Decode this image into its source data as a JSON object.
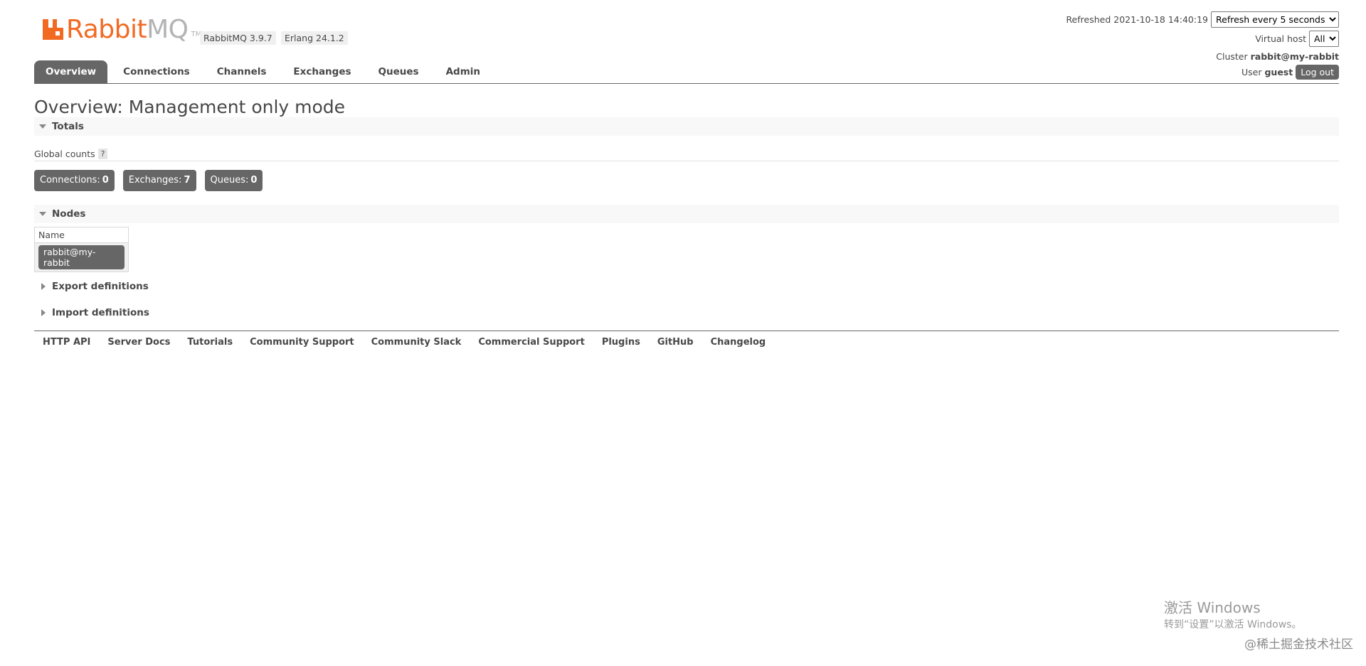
{
  "header": {
    "logo_text_rabbit": "Rabbit",
    "logo_text_mq": "MQ",
    "logo_tm": "TM",
    "rabbitmq_version": "RabbitMQ 3.9.7",
    "erlang_version": "Erlang 24.1.2",
    "refreshed_label": "Refreshed 2021-10-18 14:40:19",
    "refresh_select_value": "Refresh every 5 seconds",
    "virtual_host_label": "Virtual host",
    "virtual_host_value": "All",
    "cluster_label": "Cluster",
    "cluster_value": "rabbit@my-rabbit",
    "user_label": "User",
    "user_value": "guest",
    "logout_label": "Log out"
  },
  "tabs": [
    {
      "label": "Overview",
      "active": true
    },
    {
      "label": "Connections",
      "active": false
    },
    {
      "label": "Channels",
      "active": false
    },
    {
      "label": "Exchanges",
      "active": false
    },
    {
      "label": "Queues",
      "active": false
    },
    {
      "label": "Admin",
      "active": false
    }
  ],
  "main": {
    "title": "Overview: Management only mode",
    "totals": {
      "heading": "Totals",
      "global_counts_label": "Global counts",
      "help_label": "?",
      "counters": [
        {
          "label": "Connections:",
          "value": "0"
        },
        {
          "label": "Exchanges:",
          "value": "7"
        },
        {
          "label": "Queues:",
          "value": "0"
        }
      ]
    },
    "nodes": {
      "heading": "Nodes",
      "column_name": "Name",
      "rows": [
        {
          "name": "rabbit@my-rabbit"
        }
      ]
    },
    "export_heading": "Export definitions",
    "import_heading": "Import definitions"
  },
  "footer": {
    "links": [
      "HTTP API",
      "Server Docs",
      "Tutorials",
      "Community Support",
      "Community Slack",
      "Commercial Support",
      "Plugins",
      "GitHub",
      "Changelog"
    ]
  },
  "watermark": {
    "activate_title": "激活 Windows",
    "activate_sub": "转到“设置”以激活 Windows。",
    "juejin": "@稀土掘金技术社区"
  },
  "colors": {
    "brand_orange": "#f26922",
    "brand_gray": "#b3b3b3",
    "dark_gray": "#666666",
    "text": "#484848"
  }
}
